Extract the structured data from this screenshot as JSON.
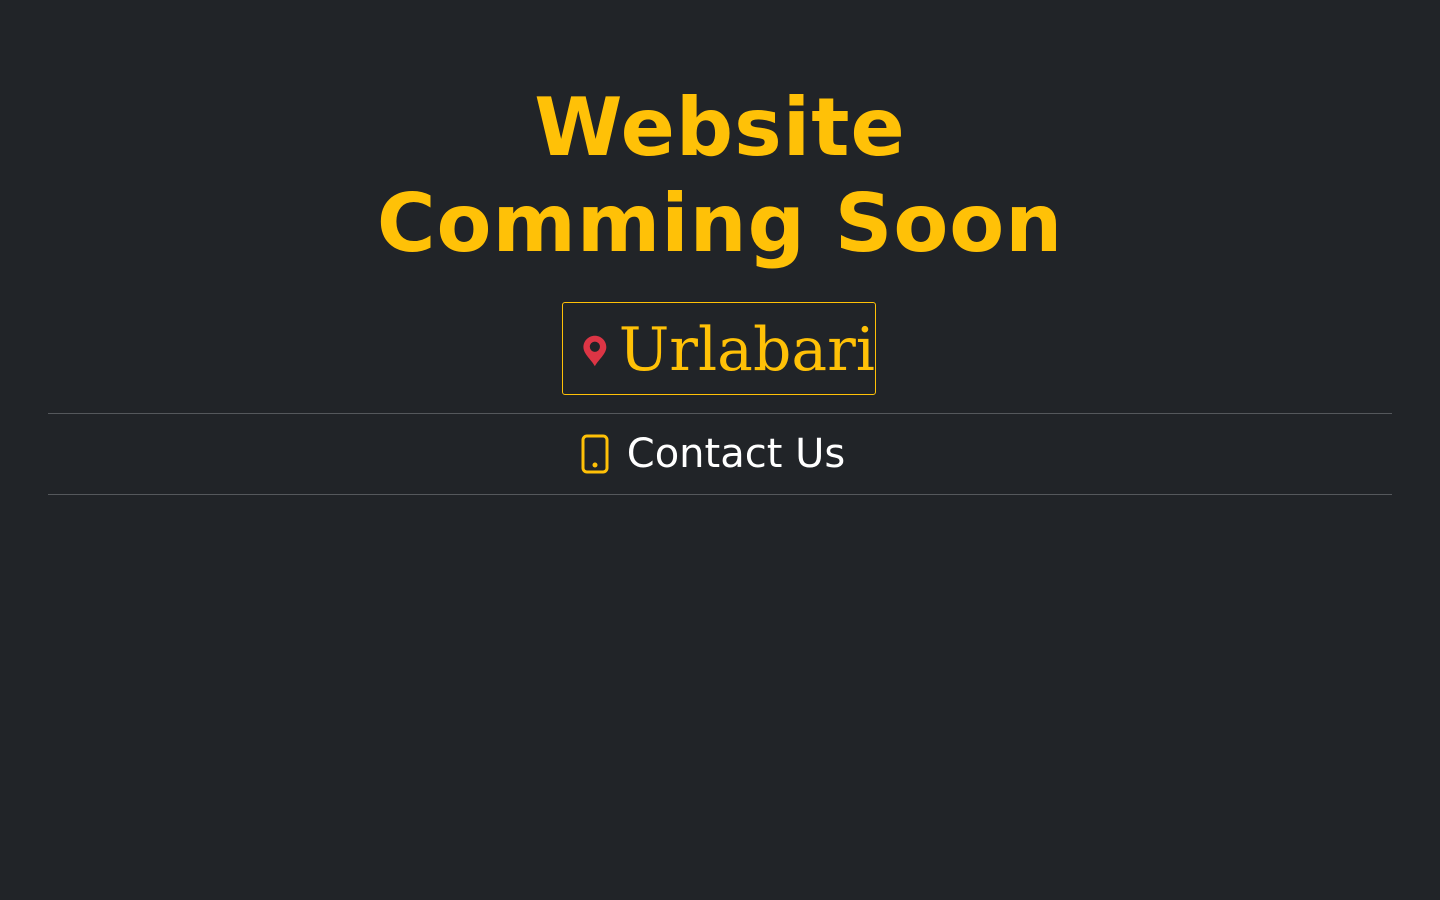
{
  "headline": {
    "line1": "Website",
    "line2": "Comming Soon"
  },
  "location": {
    "icon": "map-pin-icon",
    "text": "Urlabari"
  },
  "contact": {
    "icon": "mobile-phone-icon",
    "label": "Contact Us"
  },
  "colors": {
    "background": "#212428",
    "accent": "#ffc107",
    "pin": "#dc3545",
    "divider": "#55585c",
    "text": "#ffffff"
  }
}
